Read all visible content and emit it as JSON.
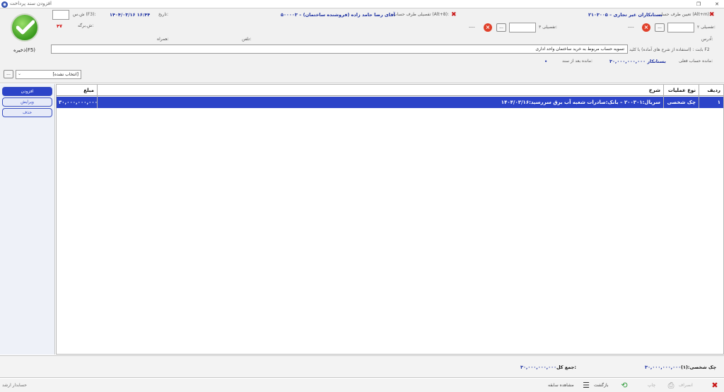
{
  "window": {
    "title": "افزودن سند پرداخت"
  },
  "header": {
    "account_side_label": "تعیین طرف حساب (Alt+m):",
    "account_side_value": "۲۱۰۳۰۰۵ – بستانکاران  غیر تجاری",
    "detail_side_label": "تفصیلی طرف حساب (Alt+8):",
    "detail_side_value": "۵۰۰۰۰۳ – آقای رضا حامد زاده (فروشنده ساختمان)",
    "date_label": "تاریخ:",
    "date_value": "۱۴۰۴/۰۳/۱۶   ۱۶:۴۴",
    "doc_number_label": "ش.س (F3):",
    "sheet_number_label": "ش.برگه:",
    "sheet_number_value": "۴۷",
    "detail2_label": "تفصیلی ۲:",
    "detail3_label": "تفصیلی ۳:",
    "detail2_value": "----",
    "detail3_value": "----",
    "address_label": "آدرس:",
    "phone_label": "تلفن:",
    "mobile_label": "همراه:",
    "description_label": "بابت : (استفاده از شرح های آماده) با کلید F2",
    "description_value": "تسویه حساب مربوط به خرید ساختمان واحد اداری",
    "final_balance_label": "مانده حساب فعلی:",
    "final_balance_value": "۳۰,۰۰۰,۰۰۰,۰۰۰ بستانکار",
    "after_doc_balance_label": "مانده بعد از سند:",
    "after_doc_balance_value": "•",
    "select_value": "[انتخاب نشده]",
    "dots": "...",
    "save_label": "ذخیره(F5)"
  },
  "side": {
    "add_label": "افزودن",
    "edit_label": "ویرایش",
    "delete_label": "حذف"
  },
  "grid": {
    "columns": {
      "row": "ردیف",
      "op_type": "نوع عملیات",
      "desc": "شرح",
      "amount": "مبلغ"
    },
    "rows": [
      {
        "row": "۱",
        "op_type": "چک شخصی",
        "desc": "سریال:۲۰۰۳۰۱ – بانک:صادرات شعبه آب برق سررسید:۱۴۰۴/۰۳/۱۶",
        "amount": "۳۰,۰۰۰,۰۰۰,۰۰۰"
      }
    ]
  },
  "footer": {
    "cheque_label": "چک شخصی:(۱)",
    "cheque_value": "۳۰,۰۰۰,۰۰۰,۰۰۰",
    "total_label": "جمع کل:",
    "total_value": "۳۰,۰۰۰,۰۰۰,۰۰۰"
  },
  "statusbar": {
    "cancel_label": "انصراف",
    "print_label": "چاپ",
    "back_label": "بازگشت",
    "history_label": "مشاهده سابقه",
    "user_label": "حسابدار ارشد"
  }
}
